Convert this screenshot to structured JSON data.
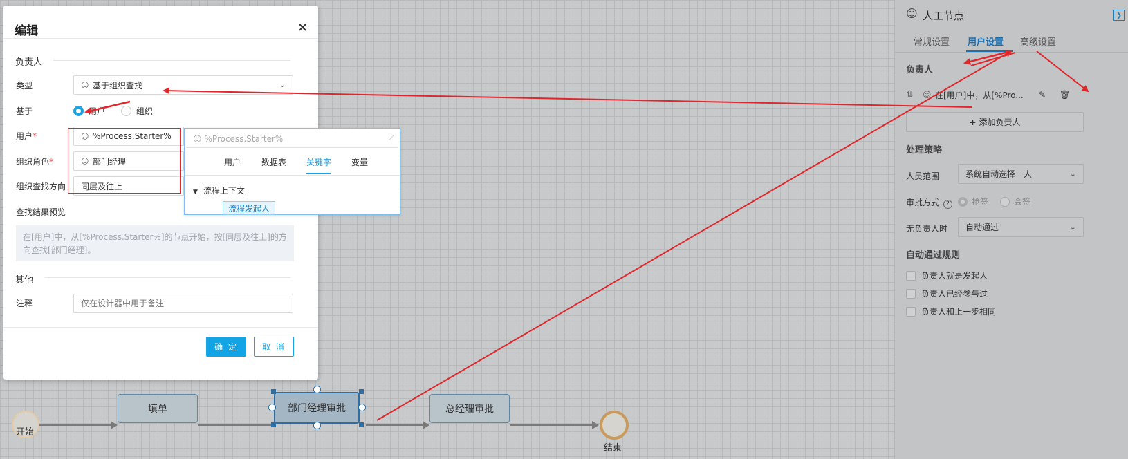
{
  "dialog": {
    "title": "编辑",
    "close_icon": "×",
    "section_owner": "负责人",
    "type_label": "类型",
    "type_value": "基于组织查找",
    "based_label": "基于",
    "radio_user": "用户",
    "radio_org": "组织",
    "user_label": "用户",
    "user_value": "%Process.Starter%",
    "org_role_label": "组织角色",
    "org_role_value": "部门经理",
    "direction_label": "组织查找方向",
    "direction_value": "同层及往上",
    "preview_label": "查找结果预览",
    "preview_text": "在[用户]中，从[%Process.Starter%]的节点开始，按[同层及往上]的方向查找[部门经理]。",
    "section_other": "其他",
    "note_label": "注释",
    "note_placeholder": "仅在设计器中用于备注",
    "ok_button": "确 定",
    "cancel_button": "取 消",
    "required_mark": "*"
  },
  "popup": {
    "input_placeholder": "%Process.Starter%",
    "tabs": [
      "用户",
      "数据表",
      "关键字",
      "变量"
    ],
    "active_tab": "关键字",
    "tree_node": "流程上下文",
    "tree_leaf": "流程发起人"
  },
  "flow": {
    "start_label": "开始",
    "end_label": "结束",
    "task1": "填单",
    "task2": "部门经理审批",
    "task3": "总经理审批"
  },
  "panel": {
    "title": "人工节点",
    "tabs": [
      "常规设置",
      "用户设置",
      "高级设置"
    ],
    "active_tab": "用户设置",
    "section_owner": "负责人",
    "owner_item": "在[用户]中，从[%Pro...",
    "add_owner": "添加负责人",
    "section_strategy": "处理策略",
    "scope_label": "人员范围",
    "scope_value": "系统自动选择一人",
    "approve_label": "审批方式",
    "approve_opt1": "抢签",
    "approve_opt2": "会签",
    "no_owner_label": "无负责人时",
    "no_owner_value": "自动通过",
    "section_auto": "自动通过规则",
    "rules": [
      "负责人就是发起人",
      "负责人已经参与过",
      "负责人和上一步相同"
    ]
  },
  "colors": {
    "accent": "#1aa3e4",
    "annotation_red": "#e0262b",
    "panel_active": "#1a6fb0"
  },
  "icons": [
    "user-icon",
    "chevron-down-icon",
    "close-icon",
    "expand-icon",
    "sort-icon",
    "edit-icon",
    "trash-icon",
    "plus-icon",
    "help-icon",
    "collapse-panel-icon",
    "caret-down-icon"
  ]
}
